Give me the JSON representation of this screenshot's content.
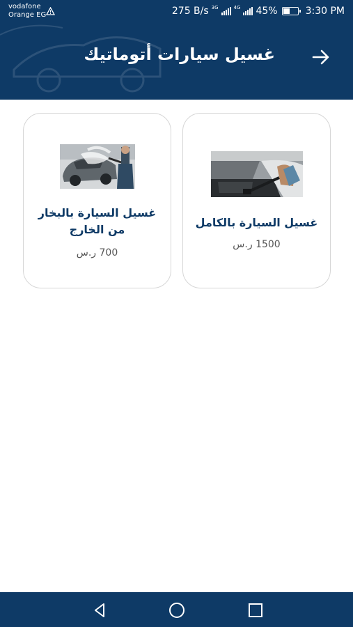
{
  "status_bar": {
    "carrier_line1": "vodafone",
    "carrier_line2": "Orange EG",
    "speed": "275 B/s",
    "net1": "3G",
    "net2": "4G",
    "battery": "45%",
    "battery_level": 0.45,
    "time": "3:30 PM"
  },
  "header": {
    "title": "غسيل سيارات أتوماتيك",
    "back_icon": "arrow-right-icon",
    "background_color": "#0e3a66"
  },
  "services": [
    {
      "name": "غسيل السيارة بالكامل",
      "price": "1500 ر.س",
      "image": "interior-vacuum-photo"
    },
    {
      "name": "غسيل السيارة بالبخار من الخارج",
      "price": "700 ر.س",
      "image": "steam-wash-photo"
    }
  ],
  "nav_bar": {
    "icons": [
      "nav-back-icon",
      "nav-home-icon",
      "nav-recents-icon"
    ]
  }
}
